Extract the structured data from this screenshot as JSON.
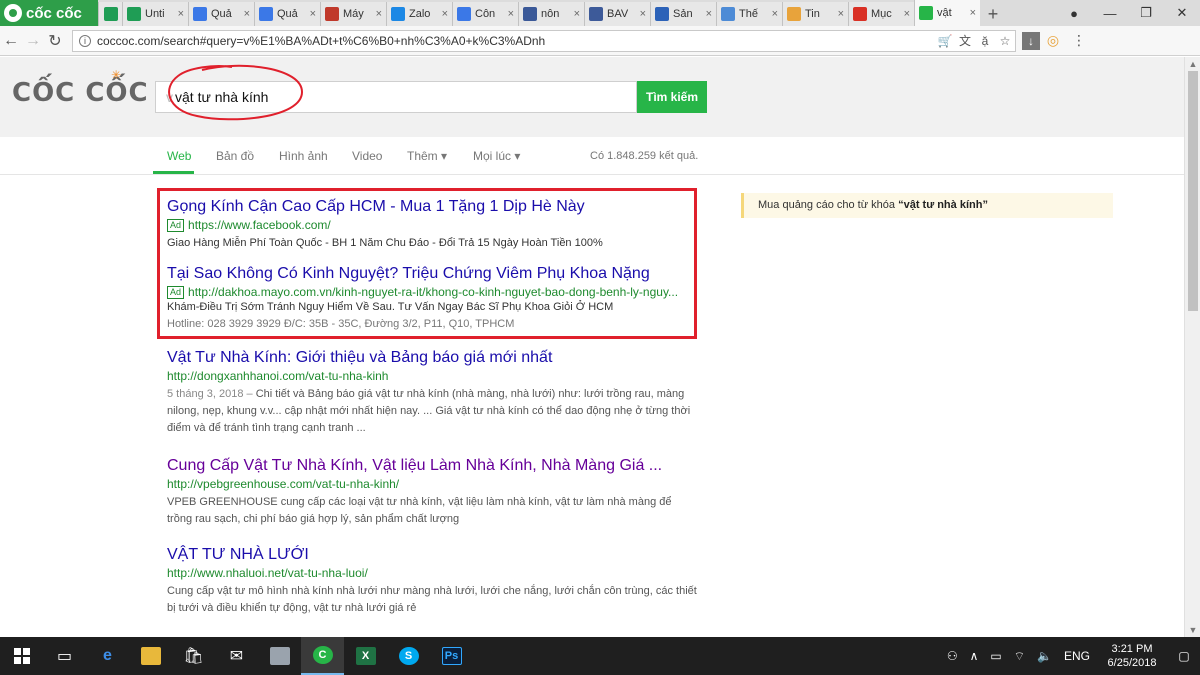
{
  "browser": {
    "brand": "cốc cốc",
    "tabs": [
      {
        "label": "",
        "icon": "sheets-icon",
        "color": "#1f9d55"
      },
      {
        "label": "Unti",
        "icon": "sheets-icon",
        "color": "#1f9d55"
      },
      {
        "label": "Quả",
        "icon": "adwords-icon",
        "color": "#3b78e7"
      },
      {
        "label": "Quả",
        "icon": "adwords-icon",
        "color": "#3b78e7"
      },
      {
        "label": "Máy",
        "icon": "site-icon",
        "color": "#c0392b"
      },
      {
        "label": "Zalo",
        "icon": "zalo-icon",
        "color": "#1c88e5"
      },
      {
        "label": "Côn",
        "icon": "adwords-icon",
        "color": "#3b78e7"
      },
      {
        "label": "nôn",
        "icon": "facebook-icon",
        "color": "#3b5998"
      },
      {
        "label": "BAV",
        "icon": "site-icon",
        "color": "#3d5a99"
      },
      {
        "label": "Sản",
        "icon": "site-icon",
        "color": "#2c62b8"
      },
      {
        "label": "Thế",
        "icon": "site-icon",
        "color": "#4d8bd6"
      },
      {
        "label": "Tin",
        "icon": "site-icon",
        "color": "#e8a33b"
      },
      {
        "label": "Mục",
        "icon": "gmail-icon",
        "color": "#d93025"
      },
      {
        "label": "vật",
        "icon": "coccoc-icon",
        "color": "#27b548",
        "active": true
      }
    ],
    "url": "coccoc.com/search#query=v%E1%BA%ADt+t%C6%B0+nh%C3%A0+k%C3%ADnh"
  },
  "search": {
    "logo": "CỐC CỐC",
    "query": "vật tư nhà kính",
    "button_label": "Tìm kiếm"
  },
  "nav": {
    "items": [
      "Web",
      "Bản đồ",
      "Hình ảnh",
      "Video",
      "Thêm ▾",
      "Mọi lúc ▾"
    ],
    "result_count": "Có 1.848.259 kết quả."
  },
  "ads": [
    {
      "title": "Gọng Kính Cận Cao Cấp HCM - Mua 1 Tặng 1 Dịp Hè Này",
      "badge": "Ad",
      "url": "https://www.facebook.com/",
      "desc": "Giao Hàng Miễn Phí Toàn Quốc - BH 1 Năm Chu Đáo - Đổi Trả 15 Ngày Hoàn Tiền 100%"
    },
    {
      "title": "Tại Sao Không Có Kinh Nguyệt? Triệu Chứng Viêm Phụ Khoa Nặng",
      "badge": "Ad",
      "url": "http://dakhoa.mayo.com.vn/kinh-nguyet-ra-it/khong-co-kinh-nguyet-bao-dong-benh-ly-nguy...",
      "desc": "Khám-Điều Trị Sớm Tránh Nguy Hiểm Về Sau. Tư Vấn Ngay Bác Sĩ Phụ Khoa Giỏi Ở HCM",
      "hotline": "Hotline: 028 3929 3929 Đ/C: 35B - 35C, Đường 3/2, P11, Q10, TPHCM"
    }
  ],
  "results": [
    {
      "title": "Vật Tư Nhà Kính: Giới thiệu và Bảng báo giá mới nhất",
      "url": "http://dongxanhhanoi.com/vat-tu-nha-kinh",
      "date": "5 tháng 3, 2018 –",
      "desc": "Chi tiết và Bảng báo giá vật tư nhà kính (nhà màng, nhà lưới) như: lưới trồng rau, màng nilong, nẹp, khung v.v... cập nhật mới nhất hiện nay. ... Giá vật tư nhà kính có thể dao động nhẹ ở từng thời điểm và để tránh tình trạng cạnh tranh ..."
    },
    {
      "title": "Cung Cấp Vật Tư Nhà Kính, Vật liệu Làm Nhà Kính, Nhà Màng Giá ...",
      "url": "http://vpebgreenhouse.com/vat-tu-nha-kinh/",
      "desc": "VPEB GREENHOUSE cung cấp các loại vật tư nhà kính, vật liệu làm nhà kính, vật tư làm nhà màng để trồng rau sạch, chi phí báo giá hợp lý, sản phẩm chất lượng"
    },
    {
      "title": "VẬT TƯ NHÀ LƯỚI",
      "url": "http://www.nhaluoi.net/vat-tu-nha-luoi/",
      "desc": "Cung cấp vật tư mô hình nhà kính nhà lưới như màng nhà lưới, lưới che nắng, lưới chắn côn trùng, các thiết bị tưới và điều khiển tự động, vật tư nhà lưới giá rẻ"
    }
  ],
  "side_ad": {
    "prefix": "Mua quảng cáo cho từ khóa ",
    "keyword": "“vật tư nhà kính”"
  },
  "taskbar": {
    "language": "ENG",
    "time": "3:21 PM",
    "date": "6/25/2018"
  }
}
